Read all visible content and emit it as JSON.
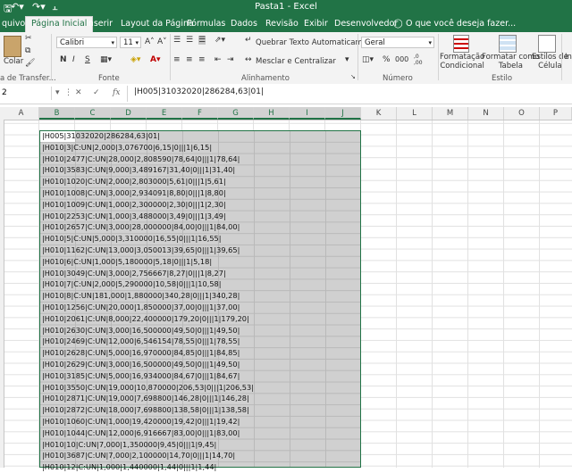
{
  "window": {
    "title": "Pasta1 - Excel"
  },
  "qat": {
    "save_icon": "save-icon",
    "undo_icon": "undo-icon",
    "redo_icon": "redo-icon"
  },
  "tabs": [
    {
      "label": "quivo"
    },
    {
      "label": "Página Inicial",
      "active": true
    },
    {
      "label": "Inserir"
    },
    {
      "label": "Layout da Página"
    },
    {
      "label": "Fórmulas"
    },
    {
      "label": "Dados"
    },
    {
      "label": "Revisão"
    },
    {
      "label": "Exibir"
    },
    {
      "label": "Desenvolvedor"
    },
    {
      "label": "O que você deseja fazer..."
    }
  ],
  "ribbon": {
    "paste_label": "Colar",
    "clipboard_label": "a de Transfer...",
    "font_name": "Calibri",
    "font_size": "11",
    "bold": "N",
    "italic": "I",
    "underline": "S",
    "font_group": "Fonte",
    "wrap_text": "Quebrar Texto Automaticamente",
    "merge_center": "Mesclar e Centralizar",
    "alignment_group": "Alinhamento",
    "number_format": "Geral",
    "percent": "%",
    "thousands": "000",
    "dec_inc": ",0\n,00",
    "number_group": "Número",
    "conditional_format": "Formatação\nCondicional",
    "format_table": "Formatar como\nTabela",
    "cell_styles": "Estilos de\nCélula",
    "styles_group": "Estilo",
    "insert_label": "In"
  },
  "formula_bar": {
    "name_box": "2",
    "fx": "fx",
    "content": "|H005|31032020|286284,63|01|"
  },
  "columns": [
    "A",
    "B",
    "C",
    "D",
    "E",
    "F",
    "G",
    "H",
    "I",
    "J",
    "K",
    "L",
    "M",
    "N",
    "O",
    "P"
  ],
  "rows": [
    "|H005|31032020|286284,63|01|",
    "|H010|3|C:UN|2,000|3,076700|6,15|0|||1|6,15|",
    "|H010|2477|C:UN|28,000|2,808590|78,64|0|||1|78,64|",
    "|H010|3583|C:UN|9,000|3,489167|31,40|0|||1|31,40|",
    "|H010|1020|C:UN|2,000|2,803000|5,61|0|||1|5,61|",
    "|H010|1008|C:UN|3,000|2,934091|8,80|0|||1|8,80|",
    "|H010|1009|C:UN|1,000|2,300000|2,30|0|||1|2,30|",
    "|H010|2253|C:UN|1,000|3,488000|3,49|0|||1|3,49|",
    "|H010|2657|C:UN|3,000|28,000000|84,00|0|||1|84,00|",
    "|H010|5|C:UN|5,000|3,310000|16,55|0|||1|16,55|",
    "|H010|1162|C:UN|13,000|3,050013|39,65|0|||1|39,65|",
    "|H010|6|C:UN|1,000|5,180000|5,18|0|||1|5,18|",
    "|H010|3049|C:UN|3,000|2,756667|8,27|0|||1|8,27|",
    "|H010|7|C:UN|2,000|5,290000|10,58|0|||1|10,58|",
    "|H010|8|C:UN|181,000|1,880000|340,28|0|||1|340,28|",
    "|H010|1256|C:UN|20,000|1,850000|37,00|0|||1|37,00|",
    "|H010|2061|C:UN|8,000|22,400000|179,20|0|||1|179,20|",
    "|H010|2630|C:UN|3,000|16,500000|49,50|0|||1|49,50|",
    "|H010|2469|C:UN|12,000|6,546154|78,55|0|||1|78,55|",
    "|H010|2628|C:UN|5,000|16,970000|84,85|0|||1|84,85|",
    "|H010|2629|C:UN|3,000|16,500000|49,50|0|||1|49,50|",
    "|H010|3185|C:UN|5,000|16,934000|84,67|0|||1|84,67|",
    "|H010|3550|C:UN|19,000|10,870000|206,53|0|||1|206,53|",
    "|H010|2871|C:UN|19,000|7,698800|146,28|0|||1|146,28|",
    "|H010|2872|C:UN|18,000|7,698800|138,58|0|||1|138,58|",
    "|H010|1060|C:UN|1,000|19,420000|19,42|0|||1|19,42|",
    "|H010|1044|C:UN|12,000|6,916667|83,00|0|||1|83,00|",
    "|H010|10|C:UN|7,000|1,350000|9,45|0|||1|9,45|",
    "|H010|3687|C:UN|7,000|2,100000|14,70|0|||1|14,70|",
    "|H010|12|C:UN|1,000|1,440000|1,44|0|||1|1,44|"
  ]
}
